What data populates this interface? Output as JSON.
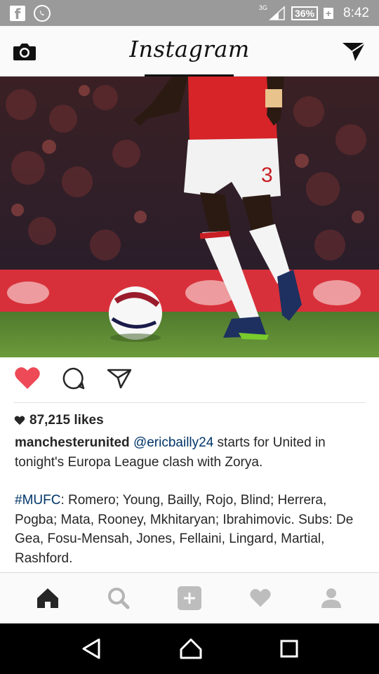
{
  "status_bar": {
    "network": "3G",
    "battery": "36%",
    "time": "8:42",
    "icons": [
      "facebook-icon",
      "whatsapp-icon",
      "signal-icon",
      "battery-icon"
    ]
  },
  "header": {
    "title": "Instagram",
    "icons": [
      "camera-icon",
      "direct-message-icon"
    ]
  },
  "post": {
    "image_alt": "Manchester United player dribbling a football on the pitch",
    "likes": "87,215 likes",
    "caption": {
      "username": "manchesterunited",
      "mention": "@ericbailly24",
      "text": " starts for United in tonight's Europa League clash with Zorya.",
      "hashtag": "#MUFC",
      "lineup": ": Romero; Young, Bailly, Rojo, Blind; Herrera, Pogba; Mata, Rooney, Mkhitaryan; Ibrahimovic. Subs: De Gea, Fosu-Mensah, Jones, Fellaini, Lingard, Martial, Rashford."
    },
    "actions": [
      "heart-icon",
      "comment-icon",
      "share-icon"
    ]
  },
  "tabbar": {
    "items": [
      "home-icon",
      "search-icon",
      "add-icon",
      "activity-icon",
      "profile-icon"
    ]
  },
  "colors": {
    "like_red": "#ed4956",
    "link_blue": "#003569",
    "status_bar": "#9a9a9a"
  }
}
